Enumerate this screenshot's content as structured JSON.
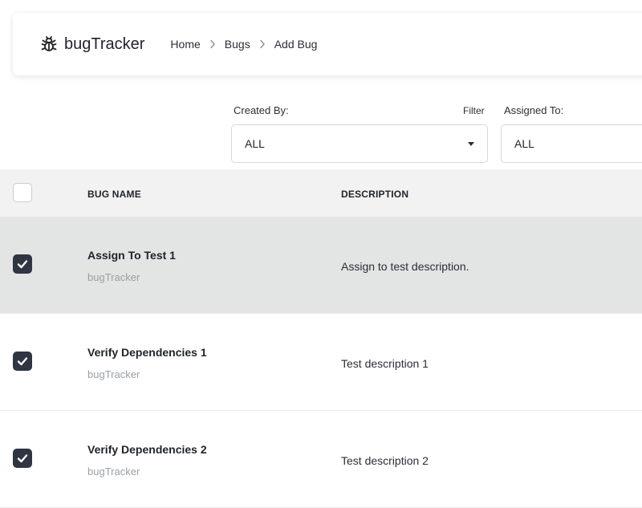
{
  "app": {
    "name": "bugTracker",
    "icon": "bug-icon"
  },
  "breadcrumb": [
    {
      "label": "Home"
    },
    {
      "label": "Bugs"
    },
    {
      "label": "Add Bug"
    }
  ],
  "filters": {
    "created_by": {
      "label": "Created By:",
      "value": "ALL"
    },
    "filter_label": "Filter",
    "assigned_to": {
      "label": "Assigned To:",
      "value": "ALL"
    }
  },
  "table": {
    "columns": {
      "bug_name": "BUG NAME",
      "description": "DESCRIPTION"
    },
    "rows": [
      {
        "name": "Assign To Test 1",
        "project": "bugTracker",
        "description": "Assign to test description.",
        "checked": true,
        "highlighted": true
      },
      {
        "name": "Verify Dependencies 1",
        "project": "bugTracker",
        "description": "Test description 1",
        "checked": true,
        "highlighted": false
      },
      {
        "name": "Verify Dependencies 2",
        "project": "bugTracker",
        "description": "Test description 2",
        "checked": true,
        "highlighted": false
      }
    ]
  },
  "colors": {
    "checkbox_checked": "#2f3542",
    "row_highlight": "#e3e4e4",
    "header_bg": "#f2f2f2"
  }
}
